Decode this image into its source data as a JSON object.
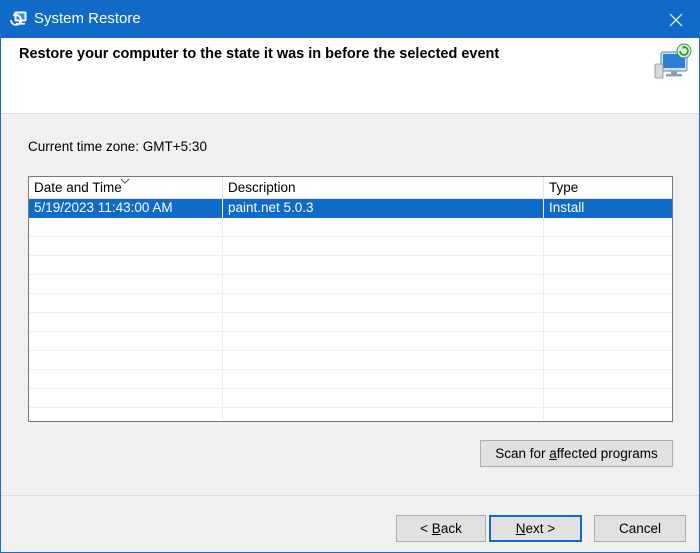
{
  "window": {
    "title": "System Restore",
    "app_icon": "system-restore-icon",
    "accent_color": "#0f6ac8"
  },
  "header": {
    "heading": "Restore your computer to the state it was in before the selected event",
    "icon": "system-restore-wizard-icon"
  },
  "timezone_label": "Current time zone: GMT+5:30",
  "restore_points": {
    "columns": [
      "Date and Time",
      "Description",
      "Type"
    ],
    "sorted_by": "Date and Time",
    "rows": [
      {
        "date_time": "5/19/2023 11:43:00 AM",
        "description": "paint.net 5.0.3",
        "type": "Install",
        "selected": true
      }
    ]
  },
  "buttons": {
    "scan": {
      "pre": "Scan for ",
      "accel": "a",
      "post": "ffected programs"
    },
    "back": {
      "pre": "< ",
      "accel": "B",
      "post": "ack"
    },
    "next": {
      "pre": "",
      "accel": "N",
      "post": "ext >"
    },
    "cancel": "Cancel"
  }
}
